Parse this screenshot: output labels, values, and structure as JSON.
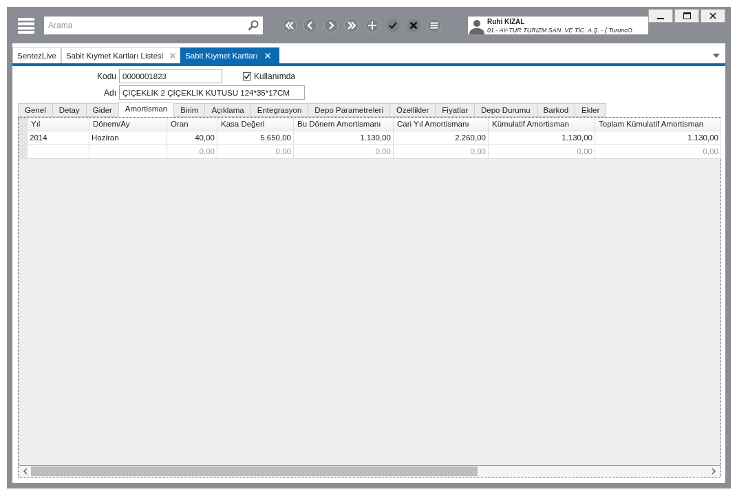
{
  "search": {
    "placeholder": "Arama"
  },
  "user": {
    "name": "Ruhi KIZAL",
    "company": "01 - AY-TUR TURIZM SAN. VE TİC. A.Ş. - ( TuruncO"
  },
  "doc_tabs": [
    {
      "label": "SentezLive",
      "selected": false,
      "closable": false
    },
    {
      "label": "Sabit Kıymet Kartları Listesi",
      "selected": false,
      "closable": true
    },
    {
      "label": "Sabit Kıymet Kartları",
      "selected": true,
      "closable": true
    }
  ],
  "form": {
    "code_label": "Kodu",
    "code": "0000001823",
    "in_use_label": "Kullanımda",
    "in_use": true,
    "name_label": "Adı",
    "name": "ÇİÇEKLİK 2 ÇİÇEKLİK KUTUSU 124*35*17CM"
  },
  "tabs": [
    {
      "label": "Genel",
      "selected": false
    },
    {
      "label": "Detay",
      "selected": false
    },
    {
      "label": "Gider",
      "selected": false
    },
    {
      "label": "Amortisman",
      "selected": true
    },
    {
      "label": "Birim",
      "selected": false
    },
    {
      "label": "Açıklama",
      "selected": false
    },
    {
      "label": "Entegrasyon",
      "selected": false
    },
    {
      "label": "Depo Parametreleri",
      "selected": false
    },
    {
      "label": "Özellikler",
      "selected": false
    },
    {
      "label": "Fiyatlar",
      "selected": false
    },
    {
      "label": "Depo Durumu",
      "selected": false
    },
    {
      "label": "Barkod",
      "selected": false
    },
    {
      "label": "Ekler",
      "selected": false
    }
  ],
  "table": {
    "columns": [
      {
        "label": "Yıl",
        "numeric": false
      },
      {
        "label": "Dönem/Ay",
        "numeric": false
      },
      {
        "label": "Oran",
        "numeric": true
      },
      {
        "label": "Kasa Değeri",
        "numeric": true
      },
      {
        "label": "Bu Dönem Amortismanı",
        "numeric": true
      },
      {
        "label": "Cari Yıl Amortismanı",
        "numeric": true
      },
      {
        "label": "Kümulatif Amortisman",
        "numeric": true
      },
      {
        "label": "Toplam Kümulatif Amortisman",
        "numeric": true
      }
    ],
    "rows": [
      {
        "kind": "data",
        "cells": [
          "2014",
          "Haziran",
          "40,00",
          "5.650,00",
          "1.130,00",
          "2.260,00",
          "1.130,00",
          "1.130,00"
        ]
      },
      {
        "kind": "new",
        "cells": [
          "",
          "",
          "0,00",
          "0,00",
          "0,00",
          "0,00",
          "0,00",
          "0,00"
        ]
      }
    ]
  }
}
